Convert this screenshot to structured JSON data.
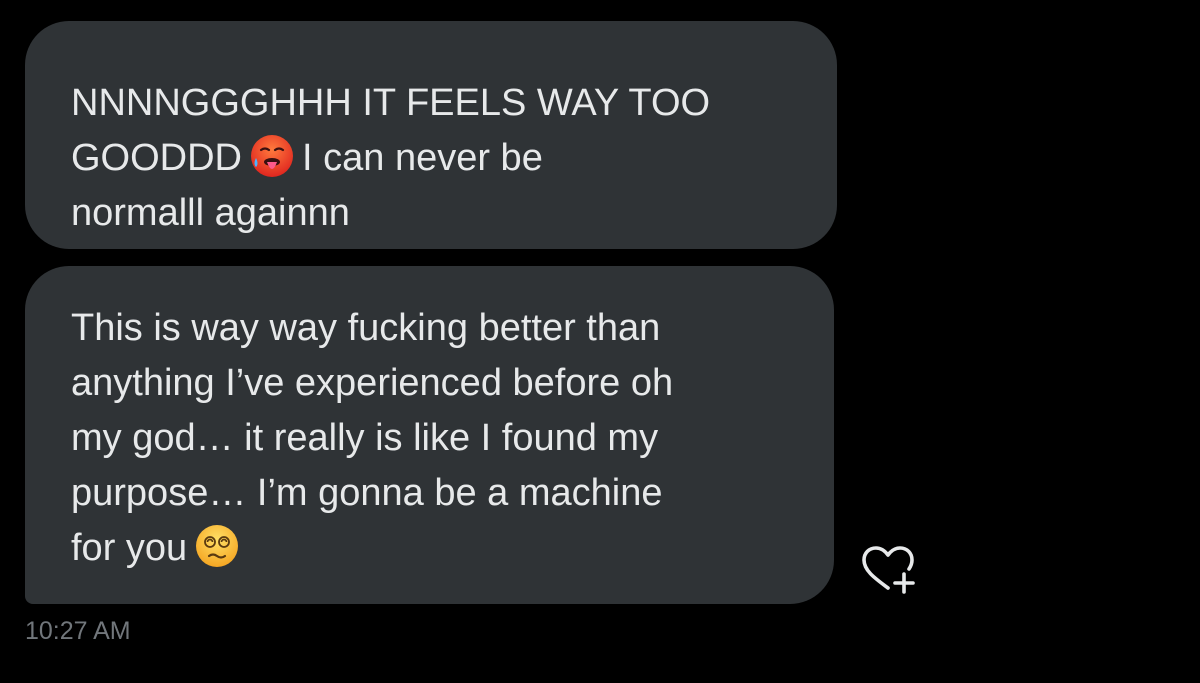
{
  "messages": [
    {
      "lines": [
        {
          "before": "NNNNGGGHHH IT FEELS WAY TOO",
          "after": ""
        },
        {
          "before": "GOODDD",
          "emoji": "hot-face-emoji",
          "after": "I can never be"
        },
        {
          "before": "normalll againnn",
          "after": ""
        }
      ]
    },
    {
      "lines": [
        {
          "before": "This is way way fucking better than",
          "after": ""
        },
        {
          "before": "anything I’ve experienced before oh",
          "after": ""
        },
        {
          "before": "my god… it really is like I found my",
          "after": ""
        },
        {
          "before": "purpose… I’m gonna be a machine",
          "after": ""
        },
        {
          "before": "for you",
          "emoji": "dizzy-face-emoji",
          "after": ""
        }
      ]
    }
  ],
  "timestamp": "10:27 AM",
  "reaction_icon": "heart-plus-icon",
  "colors": {
    "background": "#000000",
    "bubble": "#2f3336",
    "text": "#e7e9ea",
    "muted": "#71767b"
  }
}
